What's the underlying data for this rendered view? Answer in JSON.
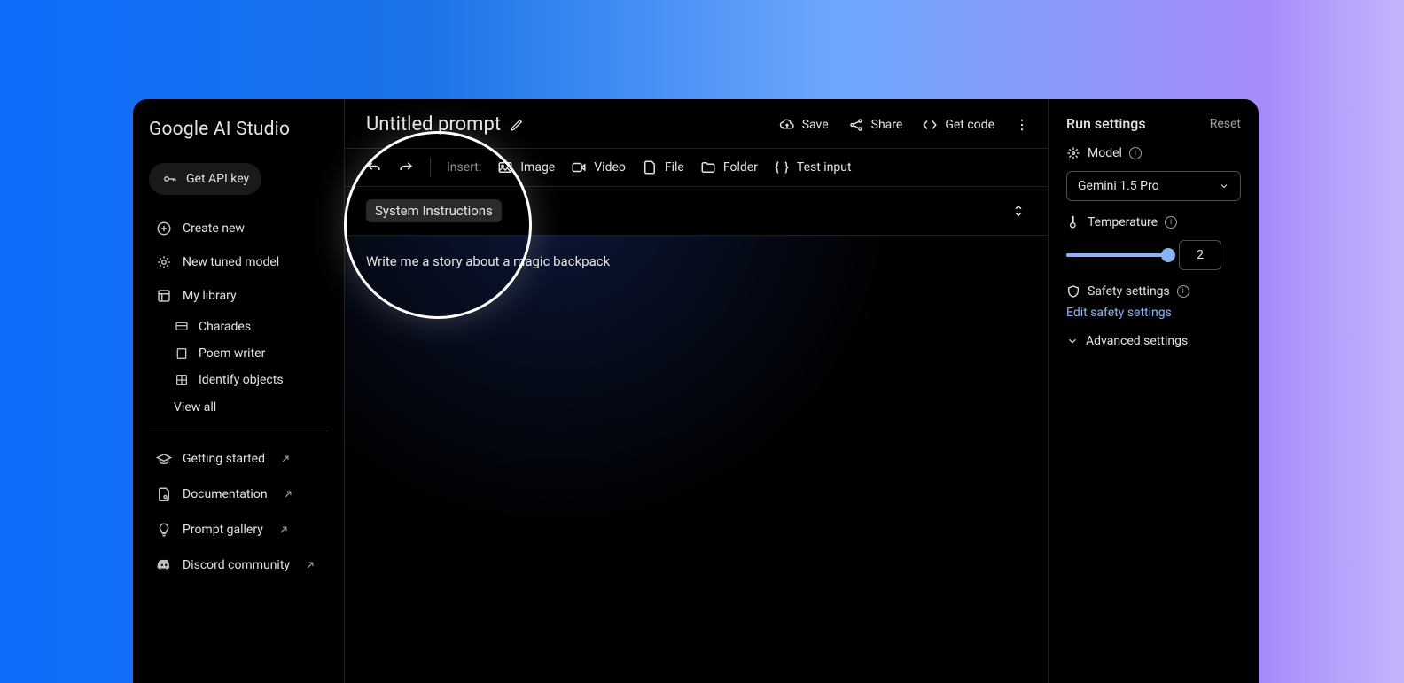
{
  "sidebar": {
    "logo": "Google AI Studio",
    "api_key": "Get API key",
    "create_new": "Create new",
    "tuned_model": "New tuned model",
    "my_library": "My library",
    "library": [
      {
        "label": "Charades"
      },
      {
        "label": "Poem writer"
      },
      {
        "label": "Identify objects"
      }
    ],
    "view_all": "View all",
    "links": {
      "getting_started": "Getting started",
      "documentation": "Documentation",
      "prompt_gallery": "Prompt gallery",
      "discord": "Discord community"
    }
  },
  "header": {
    "title": "Untitled prompt",
    "save": "Save",
    "share": "Share",
    "get_code": "Get code"
  },
  "toolbar": {
    "insert_label": "Insert:",
    "image": "Image",
    "video": "Video",
    "file": "File",
    "folder": "Folder",
    "test_input": "Test input"
  },
  "system_instructions": "System Instructions",
  "prompt_text": "Write me a story about a magic backpack",
  "run_settings": {
    "title": "Run settings",
    "reset": "Reset",
    "model_label": "Model",
    "model_value": "Gemini 1.5 Pro",
    "temperature_label": "Temperature",
    "temperature_value": "2",
    "safety_label": "Safety settings",
    "safety_link": "Edit safety settings",
    "advanced": "Advanced settings"
  }
}
